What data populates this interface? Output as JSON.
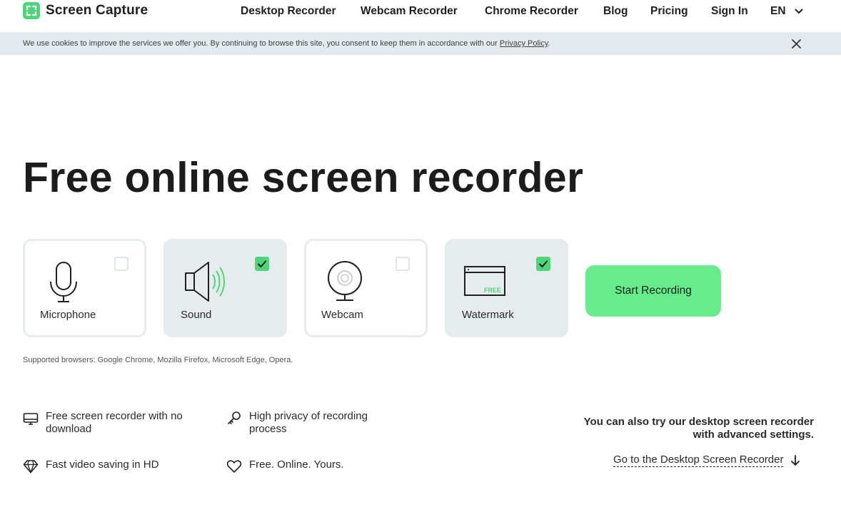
{
  "header": {
    "logo_text": "Screen Capture",
    "nav": [
      {
        "label": "Desktop Recorder"
      },
      {
        "label": "Webcam Recorder"
      },
      {
        "label": "Chrome Recorder"
      },
      {
        "label": "Blog"
      },
      {
        "label": "Pricing"
      },
      {
        "label": "Sign In"
      }
    ],
    "language": "EN"
  },
  "cookie_banner": {
    "text": "We use cookies to improve the services we offer you. By continuing to browse this site, you consent to keep them in accordance with our ",
    "link_label": "Privacy Policy",
    "suffix": "."
  },
  "main": {
    "title": "Free online screen recorder",
    "options": [
      {
        "label": "Microphone",
        "checked": false,
        "icon": "microphone-icon"
      },
      {
        "label": "Sound",
        "checked": true,
        "icon": "speaker-icon"
      },
      {
        "label": "Webcam",
        "checked": false,
        "icon": "webcam-icon"
      },
      {
        "label": "Watermark",
        "checked": true,
        "icon": "watermark-icon",
        "badge": "FREE"
      }
    ],
    "start_button": "Start Recording",
    "supported_browsers": "Supported browsers: Google Chrome, Mozilla Firefox, Microsoft Edge, Opera."
  },
  "features": [
    {
      "line1": "Free screen recorder with no",
      "line2": "download",
      "icon": "monitor-icon"
    },
    {
      "line1": "High privacy of recording",
      "line2": "process",
      "icon": "key-icon"
    },
    {
      "line1": "Fast video saving in HD",
      "line2": "",
      "icon": "diamond-icon"
    },
    {
      "line1": "Free. Online. Yours.",
      "line2": "",
      "icon": "heart-icon"
    }
  ],
  "desktop_promo": {
    "line1": "You can also try our desktop screen recorder",
    "line2": "with advanced settings.",
    "link_label": "Go to the Desktop Screen Recorder"
  },
  "colors": {
    "accent": "#4ed579",
    "button": "#66ec8a",
    "banner_bg": "#e3e9ec",
    "card_checked_bg": "#e6ebee"
  }
}
